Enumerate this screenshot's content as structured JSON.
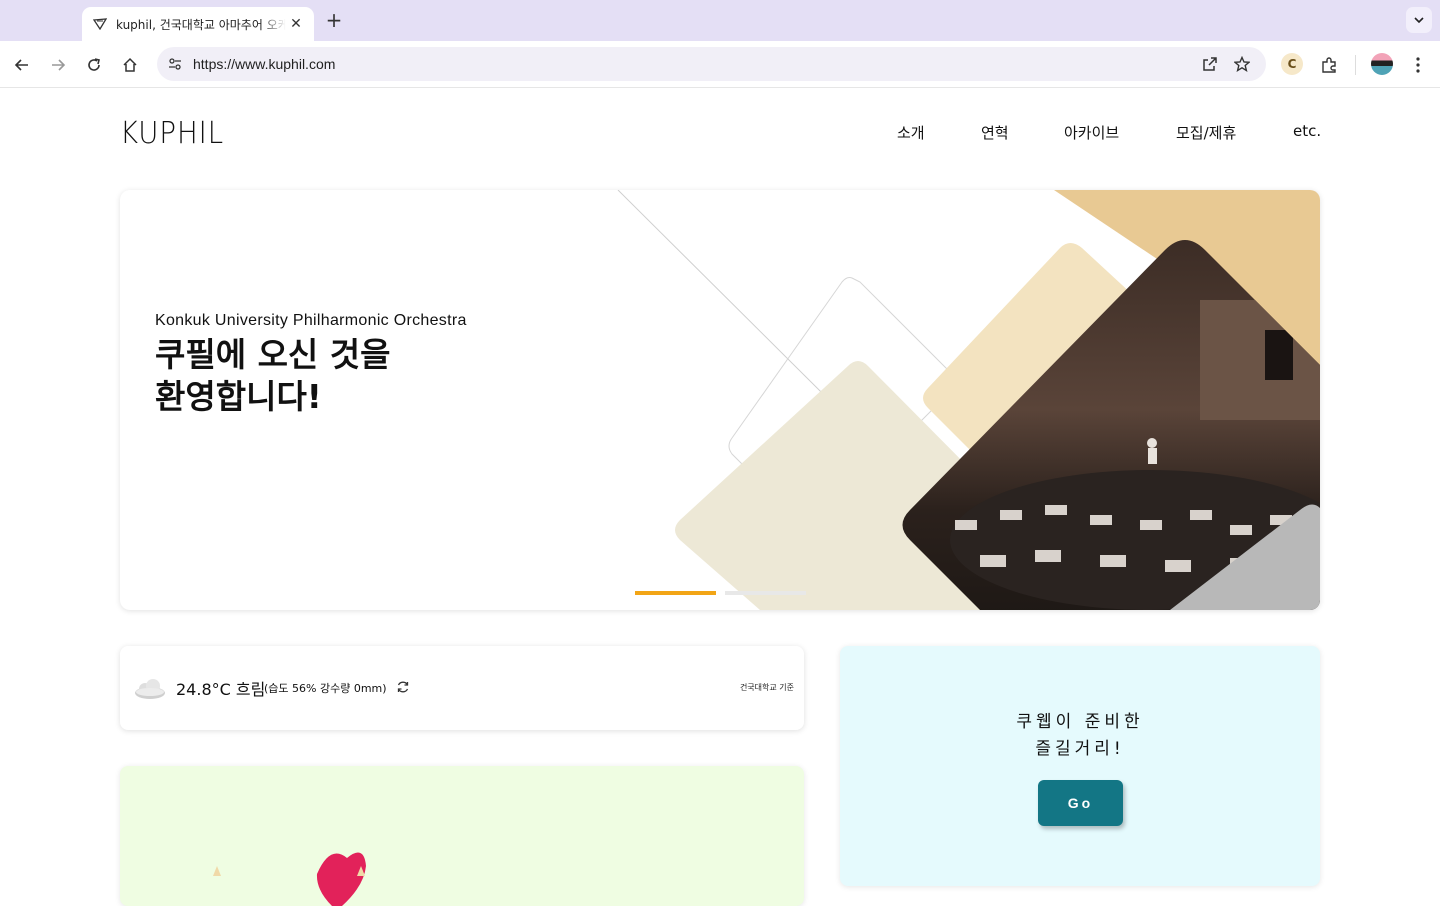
{
  "browser": {
    "tab_title": "kuphil, 건국대학교 아마추어 오케스트라",
    "new_tab_label": "+",
    "close_label": "✕",
    "url": "https://www.kuphil.com",
    "extension_label": "C"
  },
  "site": {
    "logo": "KUPHIL",
    "nav": [
      "소개",
      "연혁",
      "아카이브",
      "모집/제휴",
      "etc."
    ]
  },
  "hero": {
    "subtitle": "Konkuk University Philharmonic Orchestra",
    "title_line1": "쿠필에 오신 것을",
    "title_line2": "환영합니다!",
    "slides": 2,
    "active_slide": 1,
    "colors": {
      "accent": "#f2a516",
      "beige": "#ede8d6",
      "tan": "#f3e3c0",
      "gold": "#e8c993",
      "gray": "#b5b5b5"
    }
  },
  "weather": {
    "temp": "24.8°C 흐림",
    "detail": "(습도 56% 강수량 0mm)",
    "basis": "건국대학교 기준",
    "icon": "cloud-icon"
  },
  "fun": {
    "line1": "쿠웹이 준비한",
    "line2": "즐길거리!",
    "button": "Go",
    "button_color": "#137685"
  }
}
